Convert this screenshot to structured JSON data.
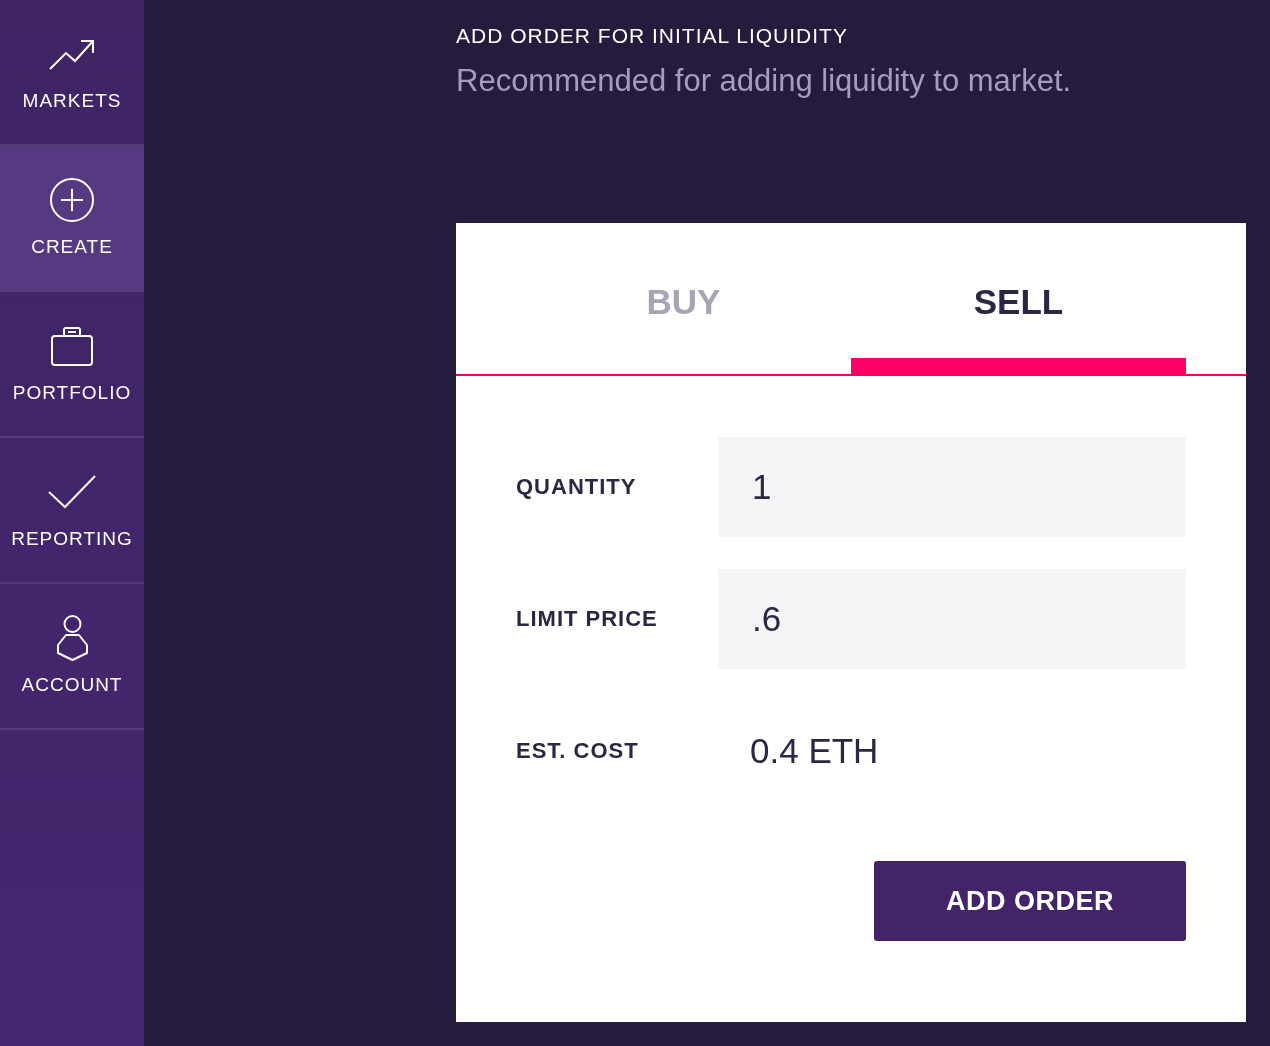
{
  "sidebar": {
    "items": [
      {
        "label": "MARKETS",
        "kind": "trend",
        "selected": false
      },
      {
        "label": "CREATE",
        "kind": "plus",
        "selected": true
      },
      {
        "label": "PORTFOLIO",
        "kind": "briefcase",
        "selected": false
      },
      {
        "label": "REPORTING",
        "kind": "check",
        "selected": false
      },
      {
        "label": "ACCOUNT",
        "kind": "person",
        "selected": false
      }
    ]
  },
  "header": {
    "title": "ADD ORDER FOR INITIAL LIQUIDITY",
    "subtitle": "Recommended for adding liquidity to market."
  },
  "order_form": {
    "tabs": [
      {
        "label": "BUY",
        "selected": false
      },
      {
        "label": "SELL",
        "selected": true
      }
    ],
    "fields": [
      {
        "label": "QUANTITY",
        "value": "1",
        "kind": "input"
      },
      {
        "label": "LIMIT PRICE",
        "value": ".6",
        "kind": "input"
      },
      {
        "label": "EST. COST",
        "value": "0.4 ETH",
        "kind": "text"
      }
    ],
    "submit": "ADD ORDER"
  }
}
